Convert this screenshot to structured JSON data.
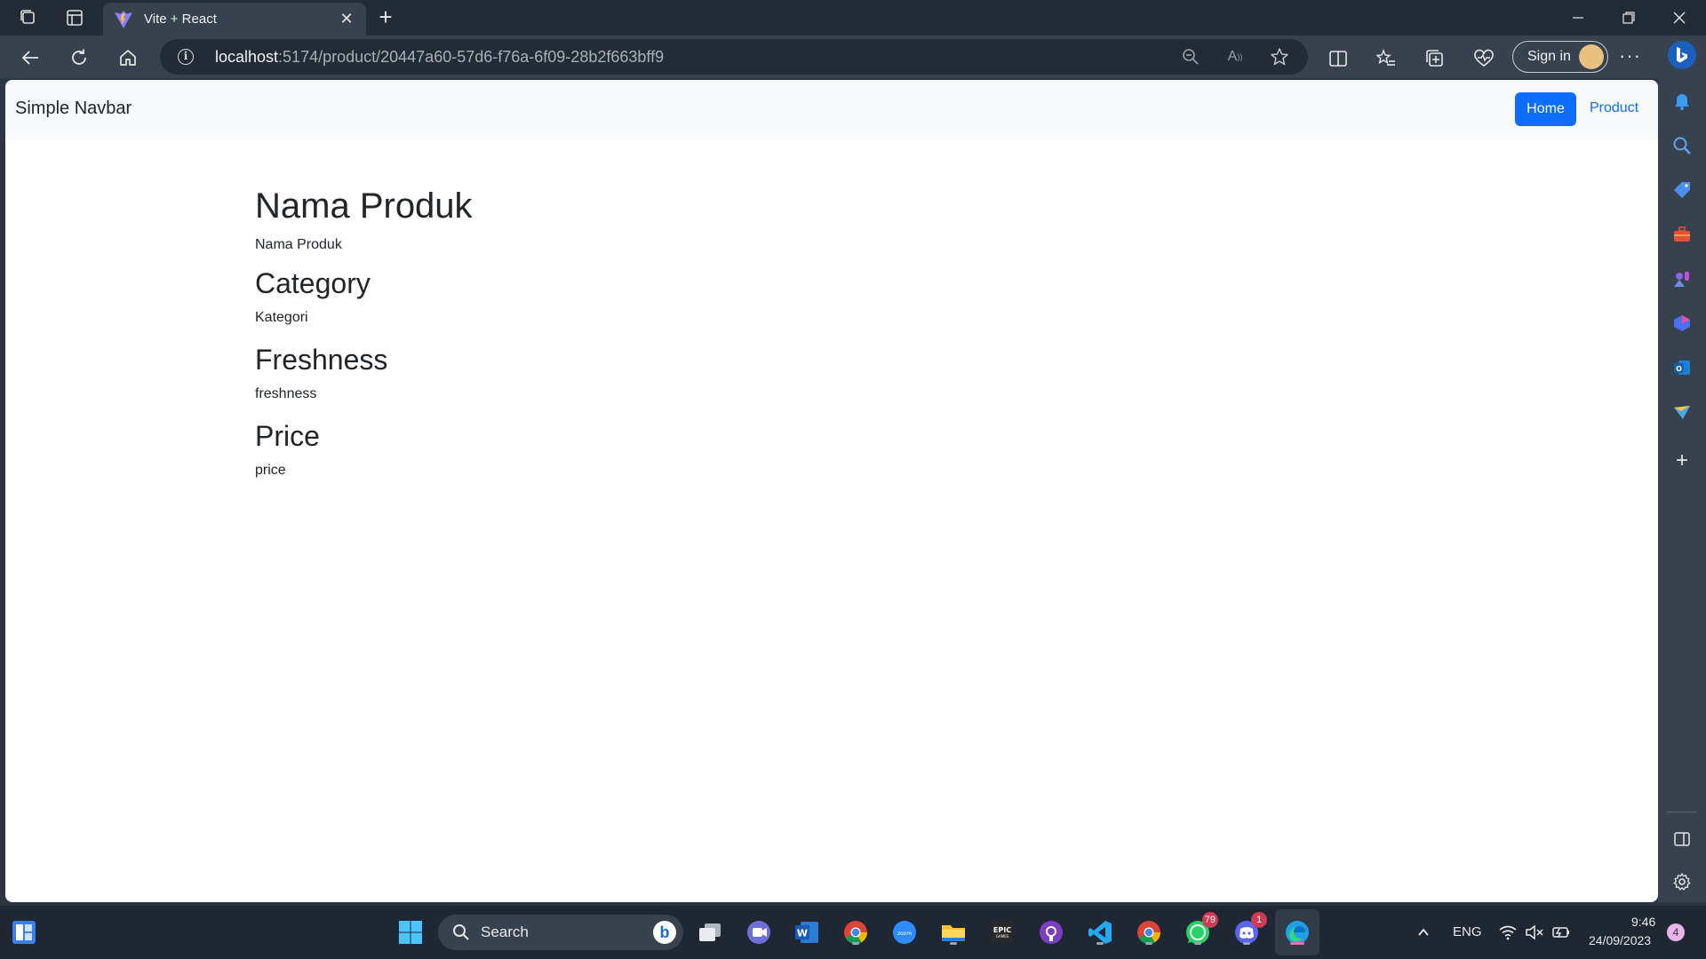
{
  "browser": {
    "tab": {
      "title": "Vite + React"
    },
    "address": {
      "host": "localhost",
      "path": ":5174/product/20447a60-57d6-f76a-6f09-28b2f663bff9"
    },
    "signin_label": "Sign in"
  },
  "page": {
    "navbar": {
      "brand": "Simple Navbar",
      "links": [
        "Home",
        "Product"
      ],
      "active": "Home"
    },
    "fields": [
      {
        "heading": "Nama Produk",
        "value": "Nama Produk"
      },
      {
        "heading": "Category",
        "value": "Kategori"
      },
      {
        "heading": "Freshness",
        "value": "freshness"
      },
      {
        "heading": "Price",
        "value": "price"
      }
    ],
    "colors": {
      "primary": "#0d6efd",
      "navbar_bg": "#f8f9fa",
      "text": "#212529"
    }
  },
  "taskbar": {
    "search_label": "Search",
    "badges": {
      "whatsapp": "79",
      "discord": "1"
    },
    "language": "ENG",
    "time": "9:46",
    "date": "24/09/2023",
    "notifications": "4"
  }
}
